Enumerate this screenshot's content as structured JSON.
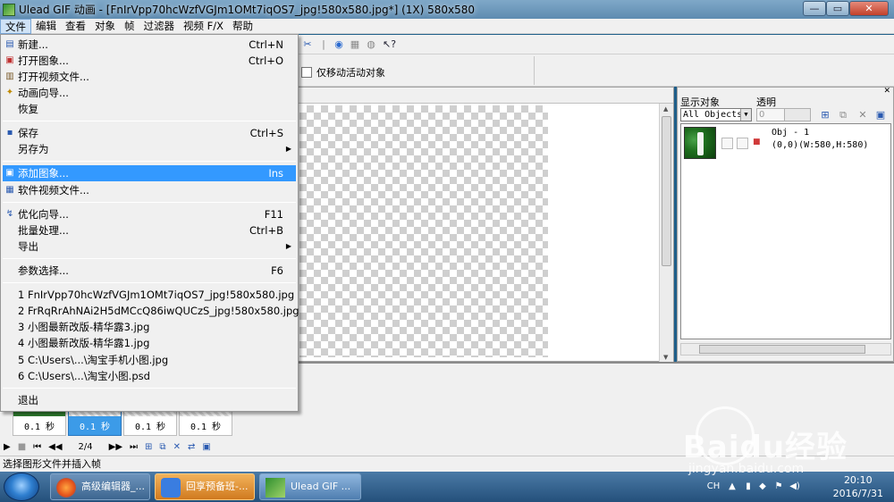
{
  "window": {
    "title": "Ulead GIF 动画 - [FnIrVpp70hcWzfVGJm1OMt7iqOS7_jpg!580x580.jpg*] (1X) 580x580",
    "min_glyph": "—",
    "max_glyph": "▭",
    "close_glyph": "✕"
  },
  "menubar": [
    "文件",
    "编辑",
    "查看",
    "对象",
    "帧",
    "过滤器",
    "视频 F/X",
    "帮助"
  ],
  "options": {
    "move_active_only": "仅移动活动对象"
  },
  "object_panel": {
    "show_objects_label": "显示对象",
    "opacity_label": "透明",
    "show_objects_value": "All Objects",
    "opacity_value": "0",
    "object": {
      "name": "Obj - 1",
      "info": "(0,0)(W:580,H:580)"
    }
  },
  "frames": [
    {
      "delay": "0.1 秒",
      "selected": false
    },
    {
      "delay": "0.1 秒",
      "selected": true
    },
    {
      "delay": "0.1 秒",
      "selected": false
    },
    {
      "delay": "0.1 秒",
      "selected": false
    }
  ],
  "playbar": {
    "frame_counter": "2/4"
  },
  "status": "选择图形文件并插入帧",
  "file_menu": {
    "items": [
      {
        "label": "新建...",
        "shortcut": "Ctrl+N",
        "icon": "new-file-icon"
      },
      {
        "label": "打开图象...",
        "shortcut": "Ctrl+O",
        "icon": "open-image-icon"
      },
      {
        "label": "打开视频文件...",
        "shortcut": "",
        "icon": "open-video-icon"
      },
      {
        "label": "动画向导...",
        "shortcut": "",
        "icon": "wizard-icon"
      },
      {
        "label": "恢复",
        "shortcut": "",
        "icon": ""
      },
      {
        "label": "保存",
        "shortcut": "Ctrl+S",
        "icon": "save-icon"
      },
      {
        "label": "另存为",
        "shortcut": "",
        "icon": "",
        "submenu": true
      },
      {
        "label": "添加图象...",
        "shortcut": "Ins",
        "icon": "add-image-icon",
        "highlighted": true
      },
      {
        "label": "软件视频文件...",
        "shortcut": "",
        "icon": "video-file-icon"
      },
      {
        "label": "优化向导...",
        "shortcut": "F11",
        "icon": "optimize-icon"
      },
      {
        "label": "批量处理...",
        "shortcut": "Ctrl+B",
        "icon": ""
      },
      {
        "label": "导出",
        "shortcut": "",
        "icon": "",
        "submenu": true
      },
      {
        "label": "参数选择...",
        "shortcut": "F6",
        "icon": ""
      },
      {
        "label": "1 FnIrVpp70hcWzfVGJm1OMt7iqOS7_jpg!580x580.jpg",
        "shortcut": "",
        "icon": ""
      },
      {
        "label": "2 FrRqRrAhNAi2H5dMCcQ86iwQUCzS_jpg!580x580.jpg",
        "shortcut": "",
        "icon": ""
      },
      {
        "label": "3 小图最新改版-精华露3.jpg",
        "shortcut": "",
        "icon": ""
      },
      {
        "label": "4 小图最新改版-精华露1.jpg",
        "shortcut": "",
        "icon": ""
      },
      {
        "label": "5 C:\\Users\\...\\淘宝手机小图.jpg",
        "shortcut": "",
        "icon": ""
      },
      {
        "label": "6 C:\\Users\\...\\淘宝小图.psd",
        "shortcut": "",
        "icon": ""
      },
      {
        "label": "退出",
        "shortcut": "",
        "icon": ""
      }
    ]
  },
  "taskbar": {
    "tasks": [
      {
        "label": "高级编辑器_...",
        "icon": "firefox-icon"
      },
      {
        "label": "回享预备班-...",
        "icon": "game-icon"
      },
      {
        "label": "Ulead GIF ...",
        "icon": "ulead-gif-icon"
      }
    ],
    "tray_ime": "CH",
    "clock_time": "20:10",
    "clock_date": "2016/7/31"
  },
  "watermark": {
    "brand": "Baidu经验",
    "url": "jingyan.baidu.com"
  },
  "colors": {
    "menu_highlight": "#3399ff",
    "selected_frame": "#3c9be8"
  }
}
